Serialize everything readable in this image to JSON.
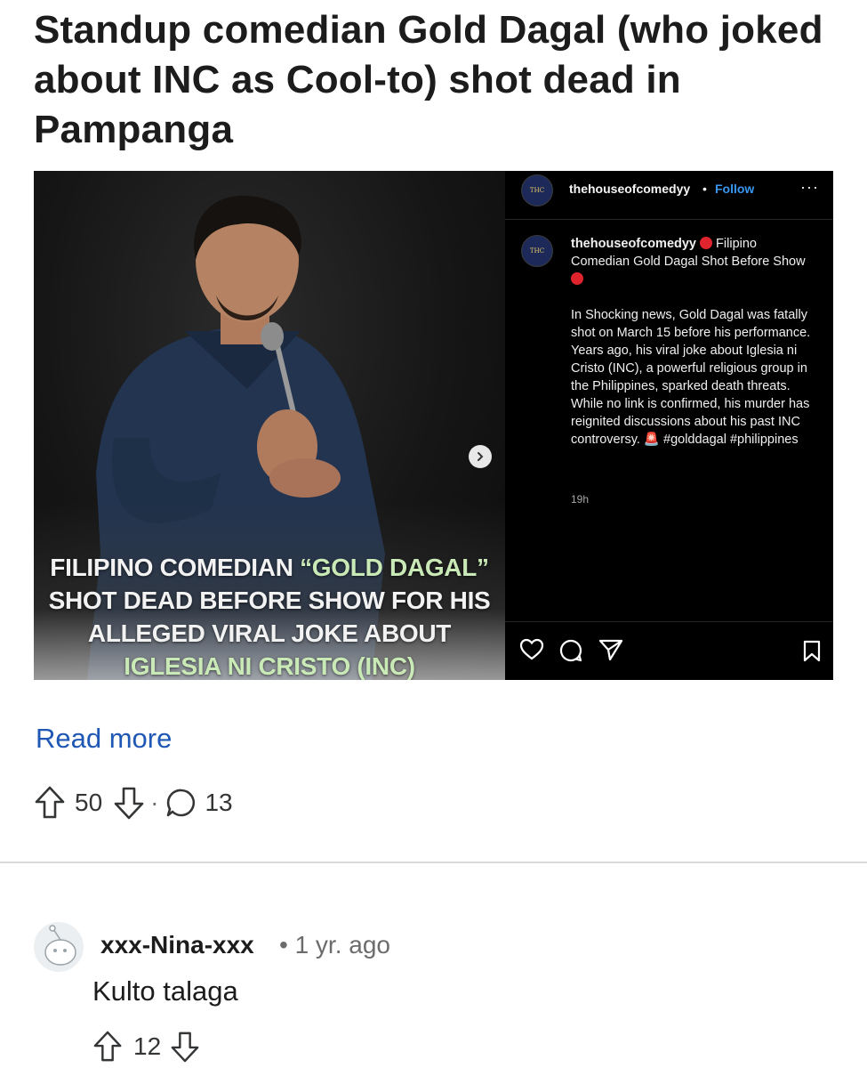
{
  "post": {
    "title": "Standup comedian Gold Dagal (who joked about INC as Cool-to) shot dead in Pampanga",
    "read_more": "Read more",
    "upvotes": "50",
    "separator": "·",
    "comments": "13"
  },
  "embed": {
    "caption_line1_white": "FILIPINO COMEDIAN ",
    "caption_line1_green": "“GOLD DAGAL”",
    "caption_line2": "SHOT DEAD BEFORE SHOW  FOR HIS",
    "caption_line3": "ALLEGED VIRAL JOKE ABOUT",
    "caption_line4": "IGLESIA NI CRISTO (INC)",
    "header_username": "thehouseofcomedyy",
    "header_dot": "•",
    "follow_label": "Follow",
    "more_label": "···",
    "avatar_text": "THC",
    "caption_username": "thehouseofcomedyy",
    "caption_title": " Filipino Comedian Gold Dagal Shot Before Show ",
    "caption_body": "In Shocking news, Gold Dagal was fatally shot on March 15 before his performance. Years ago, his viral joke about Iglesia ni Cristo (INC), a powerful religious group in the Philippines, sparked death threats. While no link is confirmed, his murder has reignited discussions about his past INC controversy. 🚨 #golddagal #philippines",
    "time": "19h",
    "icons": [
      "heart-icon",
      "comment-icon",
      "share-icon",
      "bookmark-icon",
      "chevron-right-icon"
    ]
  },
  "comment": {
    "username": "xxx-Nina-xxx",
    "meta": "• 1 yr. ago",
    "text": "Kulto talaga",
    "upvotes": "12"
  },
  "colors": {
    "link": "#1f57b5",
    "instagram_follow": "#3897f0",
    "caption_green": "#c9e9b6",
    "text": "#1c1c1c",
    "muted": "#6c6c6c"
  }
}
